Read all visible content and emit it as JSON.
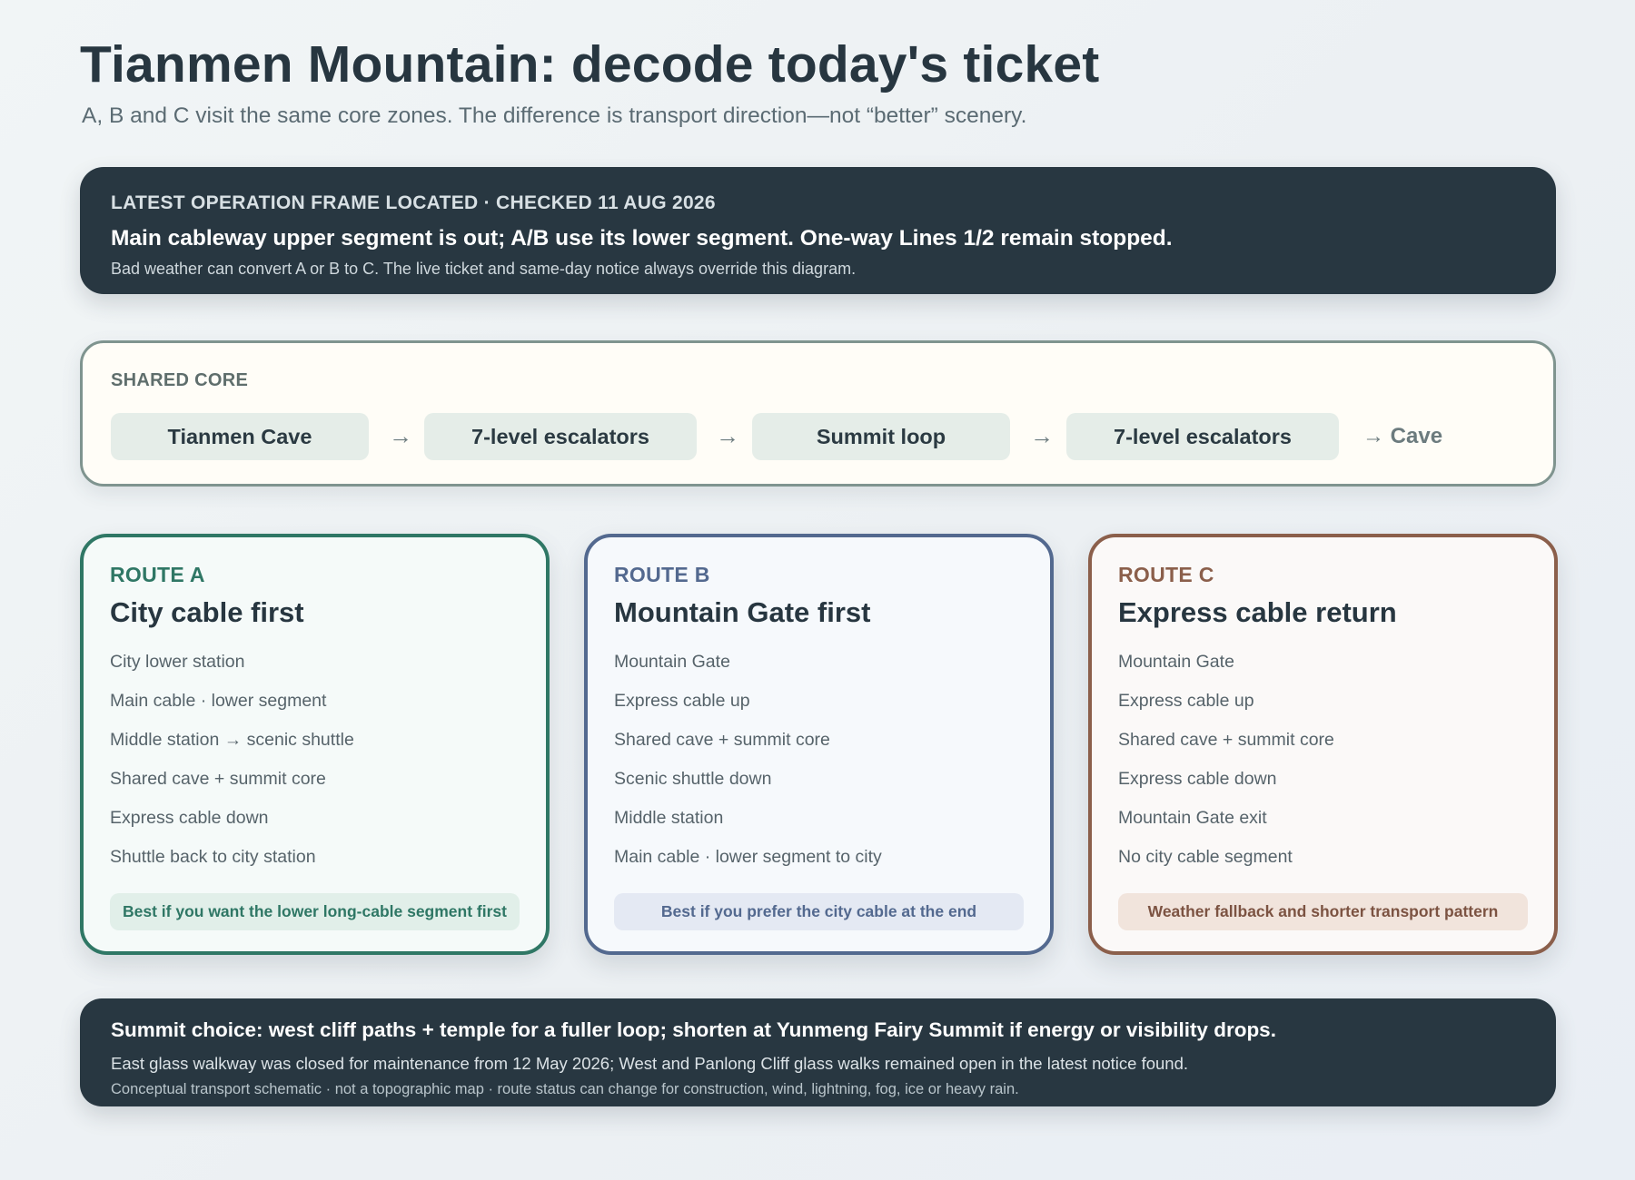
{
  "header": {
    "title": "Tianmen Mountain: decode today's ticket",
    "subtitle": "A, B and C visit the same core zones. The difference is transport direction—not “better” scenery."
  },
  "status": {
    "kicker": "LATEST OPERATION FRAME LOCATED · CHECKED 11 AUG 2026",
    "main": "Main cableway upper segment is out; A/B use its lower segment. One-way Lines 1/2 remain stopped.",
    "note": "Bad weather can convert A or B to C. The live ticket and same-day notice always override this diagram."
  },
  "core": {
    "label": "SHARED CORE",
    "steps": [
      "Tianmen Cave",
      "7-level escalators",
      "Summit loop",
      "7-level escalators"
    ],
    "arrow": "→",
    "end": "→ Cave"
  },
  "routes": [
    {
      "kicker": "ROUTE A",
      "title": "City cable first",
      "steps": [
        "City lower station",
        "Main cable · lower segment",
        "Middle station → scenic shuttle",
        "Shared cave + summit core",
        "Express cable down",
        "Shuttle back to city station"
      ],
      "tag": "Best if you want the lower long-cable segment first",
      "color": "#2f7765"
    },
    {
      "kicker": "ROUTE B",
      "title": "Mountain Gate first",
      "steps": [
        "Mountain Gate",
        "Express cable up",
        "Shared cave + summit core",
        "Scenic shuttle down",
        "Middle station",
        "Main cable · lower segment to city"
      ],
      "tag": "Best if you prefer the city cable at the end",
      "color": "#53698f"
    },
    {
      "kicker": "ROUTE C",
      "title": "Express cable return",
      "steps": [
        "Mountain Gate",
        "Express cable up",
        "Shared cave + summit core",
        "Express cable down",
        "Mountain Gate exit",
        "No city cable segment"
      ],
      "tag": "Weather fallback and shorter transport pattern",
      "color": "#8b5f4b"
    }
  ],
  "summit": {
    "main": "Summit choice: west cliff paths + temple for a fuller loop; shorten at Yunmeng Fairy Summit if energy or visibility drops.",
    "note": "East glass walkway was closed for maintenance from 12 May 2026; West and Panlong Cliff glass walks remained open in the latest notice found.",
    "fine": "Conceptual transport schematic · not a topographic map · route status can change for construction, wind, lightning, fog, ice or heavy rain."
  }
}
